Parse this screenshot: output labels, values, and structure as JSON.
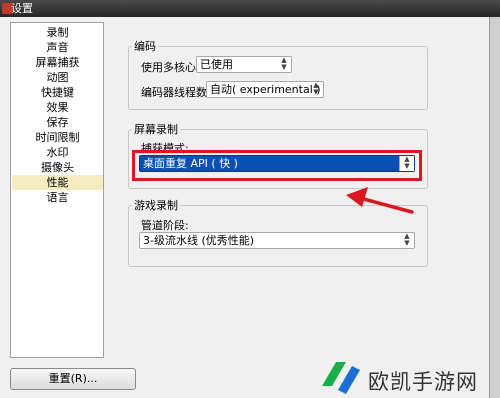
{
  "window": {
    "title": "设置"
  },
  "sidebar": {
    "items": [
      {
        "label": "录制"
      },
      {
        "label": "声音"
      },
      {
        "label": "屏幕捕获"
      },
      {
        "label": "动图"
      },
      {
        "label": "快捷键"
      },
      {
        "label": "效果"
      },
      {
        "label": "保存"
      },
      {
        "label": "时间限制"
      },
      {
        "label": "水印"
      },
      {
        "label": "摄像头"
      },
      {
        "label": "性能",
        "selected": true
      },
      {
        "label": "语言"
      }
    ]
  },
  "encoding": {
    "title": "编码",
    "multicore_label": "使用多核心:",
    "multicore_value": "已使用",
    "threads_label": "编码器线程数:",
    "threads_value": "自动( experimental )"
  },
  "screen_recording": {
    "title": "屏幕录制",
    "capture_label": "捕获模式:",
    "capture_value": "桌面重复 API ( 快 )"
  },
  "game_recording": {
    "title": "游戏录制",
    "pipeline_label": "管道阶段:",
    "pipeline_value": "3-级流水线 (优秀性能)"
  },
  "footer": {
    "reset_label": "重置(R)..."
  },
  "watermark": {
    "text": "欧凯手游网"
  },
  "colors": {
    "highlight_box": "#d9191f",
    "selected_dropdown": "#0a4fb2",
    "selected_nav": "#f5ecc2",
    "logo_green": "#19b04a",
    "logo_blue": "#1a6fd1"
  },
  "icons": [
    "app-icon",
    "dropdown-arrow-icon",
    "annotation-arrow-icon",
    "logo-icon"
  ]
}
